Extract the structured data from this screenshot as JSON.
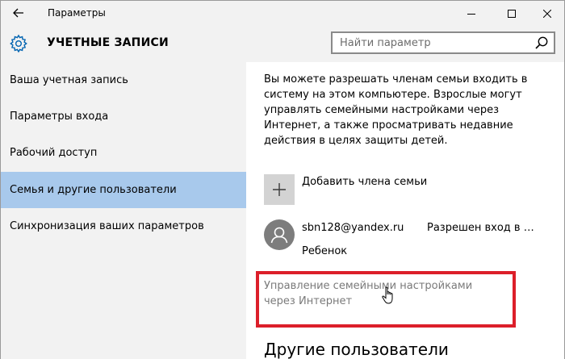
{
  "window": {
    "title": "Параметры"
  },
  "header": {
    "section_title": "УЧЕТНЫЕ ЗАПИСИ",
    "search_placeholder": "Найти параметр"
  },
  "sidebar": {
    "items": [
      {
        "label": "Ваша учетная запись",
        "active": false
      },
      {
        "label": "Параметры входа",
        "active": false
      },
      {
        "label": "Рабочий доступ",
        "active": false
      },
      {
        "label": "Семья и другие пользователи",
        "active": true
      },
      {
        "label": "Синхронизация ваших параметров",
        "active": false
      }
    ]
  },
  "main": {
    "description": "Вы можете разрешать членам семьи входить в систему на этом компьютере. Взрослые могут управлять семейными настройками через Интернет, а также просматривать недавние действия в целях защиты детей.",
    "add_member_label": "Добавить члена семьи",
    "member": {
      "email": "sbn128@yandex.ru",
      "status": "Разрешен вход в си...",
      "role": "Ребенок"
    },
    "manage_link": "Управление семейными настройками через Интернет",
    "other_users_heading": "Другие пользователи"
  },
  "colors": {
    "accent_active": "#a8c9ec",
    "highlight_border": "#dc1f2a",
    "gear_icon": "#0063b1",
    "link_gray": "#7a7a7a"
  }
}
